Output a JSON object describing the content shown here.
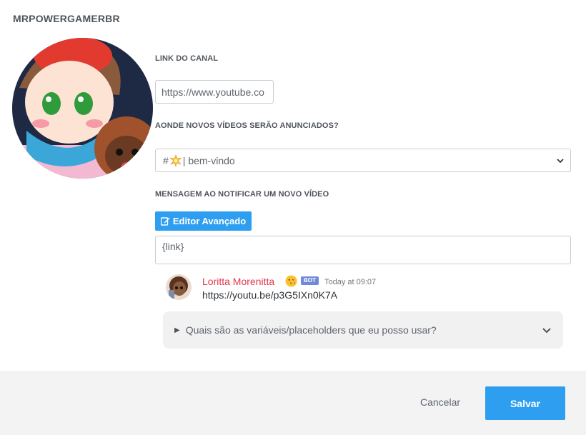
{
  "dialog": {
    "title": "MRPOWERGAMERBR"
  },
  "form": {
    "link_label": "LINK DO CANAL",
    "link_value": "https://www.youtube.co",
    "channel_label": "AONDE NOVOS VÍDEOS SERÃO ANUNCIADOS?",
    "channel_prefix": "#",
    "channel_name": "| bem-vindo",
    "message_label": "MENSAGEM AO NOTIFICAR UM NOVO VÍDEO",
    "editor_button_label": "Editor Avançado",
    "message_value": "{link}"
  },
  "preview": {
    "author": "Loritta Morenitta",
    "badge": "BOT",
    "time": "Today at 09:07",
    "content": "https://youtu.be/p3G5IXn0K7A",
    "author_color": "#e0394f"
  },
  "details": {
    "summary": "Quais são as variáveis/placeholders que eu posso usar?"
  },
  "footer": {
    "cancel_label": "Cancelar",
    "save_label": "Salvar"
  },
  "colors": {
    "accent": "#2e9ff0",
    "bot_badge": "#7289da"
  },
  "icons": {
    "channel_emoji": "explosion-emoji",
    "editor": "edit-icon",
    "select_chevron": "chevron-down-icon",
    "details_chevron": "chevron-down-icon",
    "details_marker": "triangle-right-icon",
    "preview_emoji": "kiss-face-emoji"
  }
}
